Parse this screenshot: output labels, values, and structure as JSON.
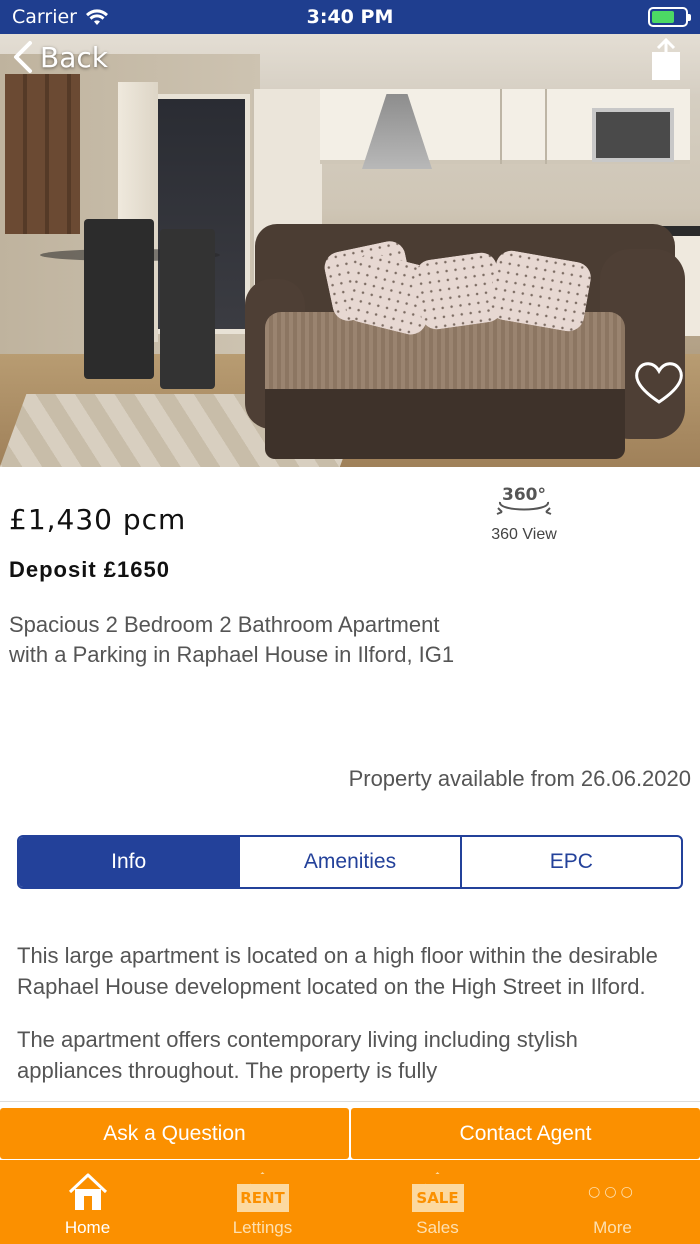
{
  "status_bar": {
    "carrier": "Carrier",
    "time": "3:40 PM"
  },
  "hero": {
    "back_label": "Back"
  },
  "property": {
    "price": "£1,430 pcm",
    "deposit": "Deposit £1650",
    "headline": "Spacious 2 Bedroom 2 Bathroom Apartment with a Parking in Raphael House in Ilford, IG1",
    "available": "Property available from 26.06.2020",
    "view360_badge": "360°",
    "view360_label": "360 View"
  },
  "tabs": [
    {
      "label": "Info",
      "active": true
    },
    {
      "label": "Amenities",
      "active": false
    },
    {
      "label": "EPC",
      "active": false
    }
  ],
  "description": {
    "para1": "This large apartment is located on a high floor within the desirable Raphael House development located on the High Street in Ilford.",
    "para2": "The apartment offers contemporary living including stylish appliances throughout. The property is fully"
  },
  "actions": {
    "ask": "Ask a Question",
    "contact": "Contact Agent"
  },
  "bottom_tabs": [
    {
      "label": "Home",
      "icon": "home-icon",
      "active": true
    },
    {
      "label": "Lettings",
      "icon": "rent-sign-icon",
      "sign": "RENT",
      "active": false
    },
    {
      "label": "Sales",
      "icon": "sale-sign-icon",
      "sign": "SALE",
      "active": false
    },
    {
      "label": "More",
      "icon": "more-icon",
      "active": false
    }
  ],
  "colors": {
    "primary": "#23419a",
    "accent": "#fb9000",
    "status_bar": "#1f3e8f"
  }
}
